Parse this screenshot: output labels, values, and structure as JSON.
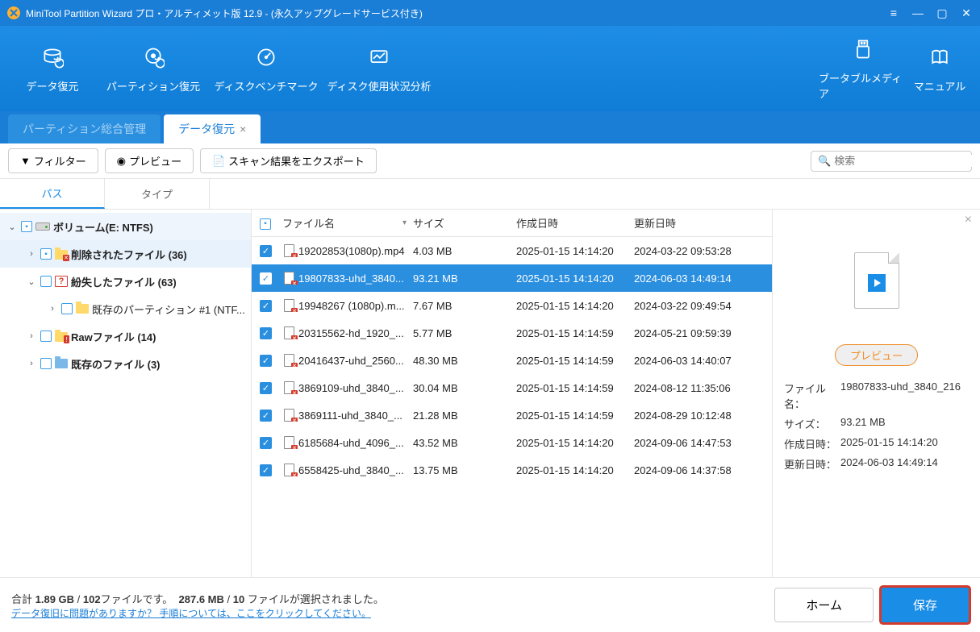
{
  "titlebar": {
    "title": "MiniTool Partition Wizard プロ・アルティメット版 12.9 - (永久アップグレードサービス付き)"
  },
  "ribbon": {
    "data_recovery": "データ復元",
    "partition_recovery": "パーティション復元",
    "disk_benchmark": "ディスクベンチマーク",
    "disk_usage": "ディスク使用状況分析",
    "bootable_media": "ブータブルメディア",
    "manual": "マニュアル"
  },
  "apptabs": {
    "partition_manage": "パーティション総合管理",
    "data_recovery": "データ復元"
  },
  "actionbar": {
    "filter": "フィルター",
    "preview": "プレビュー",
    "export": "スキャン結果をエクスポート",
    "search_placeholder": "検索"
  },
  "subtabs": {
    "path": "パス",
    "type": "タイプ"
  },
  "tree": {
    "volume": "ボリューム(E: NTFS)",
    "deleted": "削除されたファイル (36)",
    "lost": "紛失したファイル (63)",
    "existing_partition": "既存のパーティション #1 (NTF...",
    "raw": "Rawファイル (14)",
    "existing_files": "既存のファイル (3)"
  },
  "columns": {
    "filename": "ファイル名",
    "size": "サイズ",
    "created": "作成日時",
    "modified": "更新日時"
  },
  "files": [
    {
      "name": "19202853(1080p).mp4",
      "size": "4.03 MB",
      "created": "2025-01-15 14:14:20",
      "modified": "2024-03-22 09:53:28",
      "selected": false
    },
    {
      "name": "19807833-uhd_3840...",
      "size": "93.21 MB",
      "created": "2025-01-15 14:14:20",
      "modified": "2024-06-03 14:49:14",
      "selected": true
    },
    {
      "name": "19948267 (1080p).m...",
      "size": "7.67 MB",
      "created": "2025-01-15 14:14:20",
      "modified": "2024-03-22 09:49:54",
      "selected": false
    },
    {
      "name": "20315562-hd_1920_...",
      "size": "5.77 MB",
      "created": "2025-01-15 14:14:59",
      "modified": "2024-05-21 09:59:39",
      "selected": false
    },
    {
      "name": "20416437-uhd_2560...",
      "size": "48.30 MB",
      "created": "2025-01-15 14:14:59",
      "modified": "2024-06-03 14:40:07",
      "selected": false
    },
    {
      "name": "3869109-uhd_3840_...",
      "size": "30.04 MB",
      "created": "2025-01-15 14:14:59",
      "modified": "2024-08-12 11:35:06",
      "selected": false
    },
    {
      "name": "3869111-uhd_3840_...",
      "size": "21.28 MB",
      "created": "2025-01-15 14:14:59",
      "modified": "2024-08-29 10:12:48",
      "selected": false
    },
    {
      "name": "6185684-uhd_4096_...",
      "size": "43.52 MB",
      "created": "2025-01-15 14:14:20",
      "modified": "2024-09-06 14:47:53",
      "selected": false
    },
    {
      "name": "6558425-uhd_3840_...",
      "size": "13.75 MB",
      "created": "2025-01-15 14:14:20",
      "modified": "2024-09-06 14:37:58",
      "selected": false
    }
  ],
  "preview": {
    "button": "プレビュー",
    "labels": {
      "filename": "ファイル名：",
      "size": "サイズ：",
      "created": "作成日時：",
      "modified": "更新日時："
    },
    "filename": "19807833-uhd_3840_216",
    "size": "93.21 MB",
    "created": "2025-01-15 14:14:20",
    "modified": "2024-06-03 14:49:14"
  },
  "footer": {
    "summary_pre": "合計 ",
    "total_size": "1.89 GB",
    "slash": " / ",
    "total_files": "102",
    "summary_mid": "ファイルです。",
    "sel_size": "287.6 MB",
    "sel_slash": " / ",
    "sel_count": "10",
    "summary_post": " ファイルが選択されました。",
    "help_link": "データ復旧に問題がありますか？ 手順については、ここをクリックしてください。",
    "home": "ホーム",
    "save": "保存"
  }
}
